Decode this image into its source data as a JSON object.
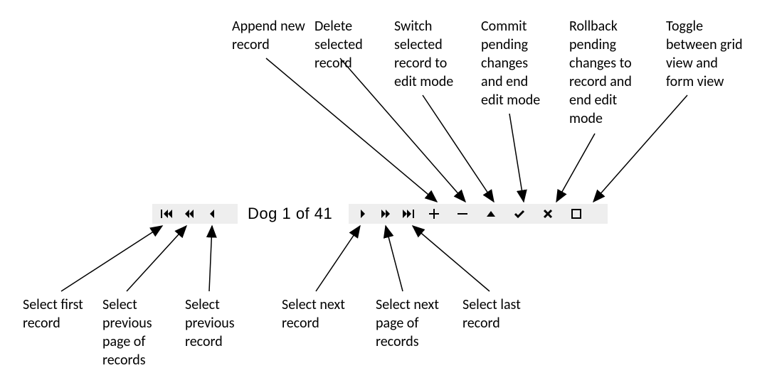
{
  "navigator": {
    "status_text": "Dog 1 of 41",
    "tooltips": {
      "first": "Select first record",
      "prev_page": "Select previous page of records",
      "prev": "Select previous record",
      "next": "Select next record",
      "next_page": "Select next page of records",
      "last": "Select last record",
      "append": "Append new record",
      "delete": "Delete selected record",
      "edit": "Switch selected record to edit mode",
      "commit": "Commit pending changes and end edit mode",
      "rollback": "Rollback pending changes to record and end edit mode",
      "toggle_view": "Toggle between grid view and form view"
    }
  },
  "labels": {
    "top": {
      "append": "Append new record",
      "delete": "Delete selected record",
      "edit": "Switch selected record to edit mode",
      "commit": "Commit pending changes and end edit mode",
      "rollback": "Rollback pending changes to record and end edit mode",
      "toggle": "Toggle between grid view and form view"
    },
    "bottom": {
      "first": "Select first record",
      "prev_page": "Select previous page of records",
      "prev": "Select previous record",
      "next": "Select next record",
      "next_page": "Select next page of records",
      "last": "Select last record"
    }
  },
  "icons": {
    "fill_color": "#000000"
  }
}
